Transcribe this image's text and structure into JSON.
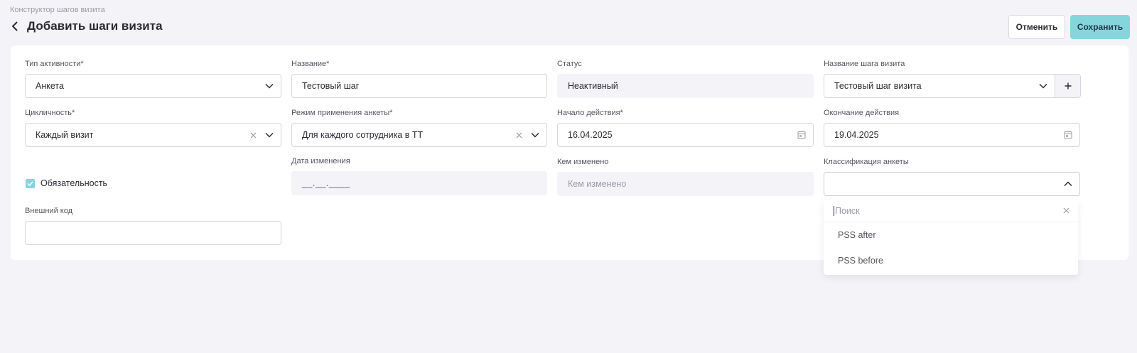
{
  "breadcrumb": "Конструктор шагов визита",
  "page_title": "Добавить шаги визита",
  "buttons": {
    "cancel": "Отменить",
    "save": "Сохранить"
  },
  "form": {
    "activity_type": {
      "label": "Тип активности*",
      "value": "Анкета"
    },
    "name": {
      "label": "Название*",
      "value": "Тестовый шаг"
    },
    "status": {
      "label": "Статус",
      "value": "Неактивный"
    },
    "step_name": {
      "label": "Название шага визита",
      "value": "Тестовый шаг визита"
    },
    "cyclicity": {
      "label": "Цикличность*",
      "value": "Каждый визит"
    },
    "survey_mode": {
      "label": "Режим применения анкеты*",
      "value": "Для каждого сотрудника в ТТ"
    },
    "start_date": {
      "label": "Начало действия*",
      "value": "16.04.2025"
    },
    "end_date": {
      "label": "Окончание действия",
      "value": "19.04.2025"
    },
    "mandatory": {
      "label": "Обязательность",
      "checked": true
    },
    "change_date": {
      "label": "Дата изменения",
      "value": "__.__.____"
    },
    "changed_by": {
      "label": "Кем изменено",
      "placeholder": "Кем изменено"
    },
    "survey_classification": {
      "label": "Классификация анкеты",
      "value": ""
    },
    "external_code": {
      "label": "Внешний код",
      "value": ""
    }
  },
  "dropdown": {
    "search_placeholder": "Поиск",
    "options": [
      "PSS after",
      "PSS before"
    ]
  },
  "colors": {
    "accent": "#85d6dc",
    "background": "#f4f4f8"
  }
}
